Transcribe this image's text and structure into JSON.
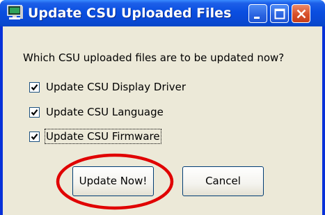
{
  "window": {
    "title": "Update CSU Uploaded Files",
    "icon": "app-monitor-icon",
    "controls": {
      "minimize": "minimize-icon",
      "maximize": "maximize-icon",
      "close": "close-icon"
    }
  },
  "dialog": {
    "prompt": "Which CSU uploaded files are to be updated now?",
    "options": [
      {
        "label": "Update CSU Display Driver",
        "checked": true
      },
      {
        "label": "Update CSU Language",
        "checked": true
      },
      {
        "label": "Update CSU Firmware",
        "checked": true,
        "focused": true
      }
    ],
    "buttons": {
      "update_now": "Update Now!",
      "cancel": "Cancel"
    }
  },
  "annotation": {
    "highlight_color": "#e00000",
    "highlights": "update_now"
  },
  "colors": {
    "titlebar": "#0a4ee0",
    "client": "#ece9d8",
    "close_button": "#d8502a"
  }
}
